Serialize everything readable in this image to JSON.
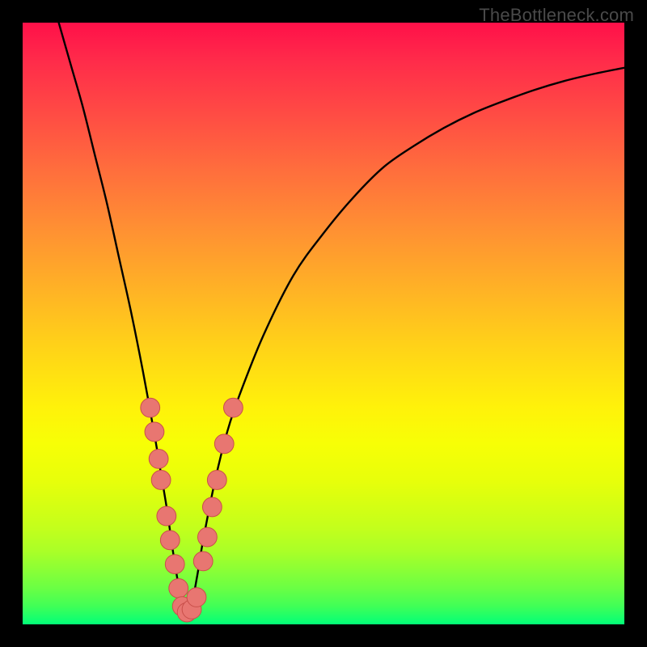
{
  "watermark": "TheBottleneck.com",
  "colors": {
    "frame": "#000000",
    "curve": "#000000",
    "marker_fill": "#e87671",
    "marker_stroke": "#c94f4a"
  },
  "chart_data": {
    "type": "line",
    "title": "",
    "xlabel": "",
    "ylabel": "",
    "xlim": [
      0,
      100
    ],
    "ylim": [
      0,
      100
    ],
    "note": "No axes, ticks, or units are rendered in the image; x/y values below are read off as percentages of the plot area (0–100 on each axis, y=0 at bottom). Curve is a V-shaped profile with minimum around x≈27.",
    "series": [
      {
        "name": "curve",
        "x": [
          6,
          8,
          10,
          12,
          14,
          16,
          18,
          20,
          22,
          23,
          24,
          25,
          26,
          27,
          28,
          29,
          30,
          32,
          34,
          36,
          40,
          45,
          50,
          55,
          60,
          65,
          70,
          75,
          80,
          85,
          90,
          95,
          100
        ],
        "y": [
          100,
          93,
          86,
          78,
          70,
          61,
          52,
          42,
          31,
          25,
          19,
          12,
          6,
          2,
          3,
          8,
          14,
          24,
          32,
          38,
          48,
          58,
          65,
          71,
          76,
          79.5,
          82.5,
          85,
          87,
          88.8,
          90.3,
          91.5,
          92.5
        ]
      }
    ],
    "markers": {
      "name": "salmon-dots",
      "note": "Pink circular markers clustered on both walls of the V near the bottom; positions as (x%, y%).",
      "points": [
        [
          21.2,
          36.0
        ],
        [
          21.9,
          32.0
        ],
        [
          22.6,
          27.5
        ],
        [
          23.0,
          24.0
        ],
        [
          23.9,
          18.0
        ],
        [
          24.5,
          14.0
        ],
        [
          25.3,
          10.0
        ],
        [
          25.9,
          6.0
        ],
        [
          26.5,
          3.0
        ],
        [
          27.3,
          2.0
        ],
        [
          28.1,
          2.5
        ],
        [
          28.9,
          4.5
        ],
        [
          30.0,
          10.5
        ],
        [
          30.7,
          14.5
        ],
        [
          31.5,
          19.5
        ],
        [
          32.3,
          24.0
        ],
        [
          33.5,
          30.0
        ],
        [
          35.0,
          36.0
        ]
      ],
      "radius_pct": 1.6
    }
  }
}
